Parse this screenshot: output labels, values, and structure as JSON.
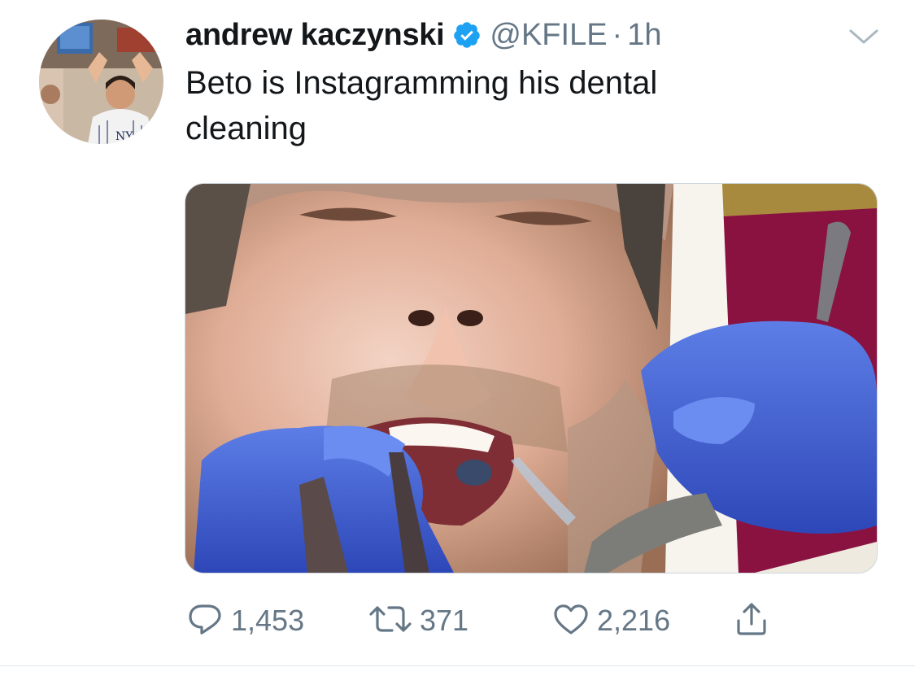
{
  "tweet": {
    "author": {
      "display_name": "andrew kaczynski",
      "handle": "@KFILE",
      "verified": true,
      "avatar_icon": "profile-photo"
    },
    "separator": "·",
    "time": "1h",
    "text": "Beto is Instagramming his dental\ncleaning",
    "media": {
      "type": "video-thumbnail"
    },
    "actions": {
      "reply": {
        "icon": "reply-icon",
        "count": "1,453"
      },
      "retweet": {
        "icon": "retweet-icon",
        "count": "371"
      },
      "like": {
        "icon": "heart-icon",
        "count": "2,216"
      },
      "share": {
        "icon": "share-icon"
      }
    }
  },
  "colors": {
    "text": "#14171a",
    "secondary": "#657786",
    "verified_blue": "#1da1f2",
    "divider": "#e1e8ed"
  }
}
